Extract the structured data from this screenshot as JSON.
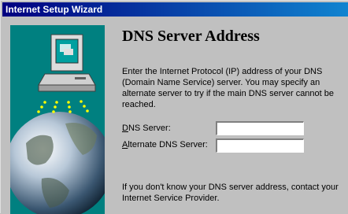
{
  "window": {
    "title": "Internet Setup Wizard"
  },
  "page": {
    "heading": "DNS Server Address",
    "description": "Enter the Internet Protocol (IP) address of your DNS (Domain Name Service) server.  You may specify an alternate server to try if the main DNS server cannot be reached.",
    "dns_server_label_accel": "D",
    "dns_server_label_rest": "NS Server:",
    "dns_server_value": "",
    "alternate_label_accel": "A",
    "alternate_label_rest": "lternate DNS Server:",
    "alternate_value": "",
    "note": "If you don't know your DNS server address, contact your Internet Service Provider."
  },
  "colors": {
    "titlebar_start": "#000080",
    "titlebar_end": "#1084d0",
    "art_background": "#008080",
    "face": "#c0c0c0"
  },
  "icons": {
    "art": "computer-with-globe-illustration"
  }
}
